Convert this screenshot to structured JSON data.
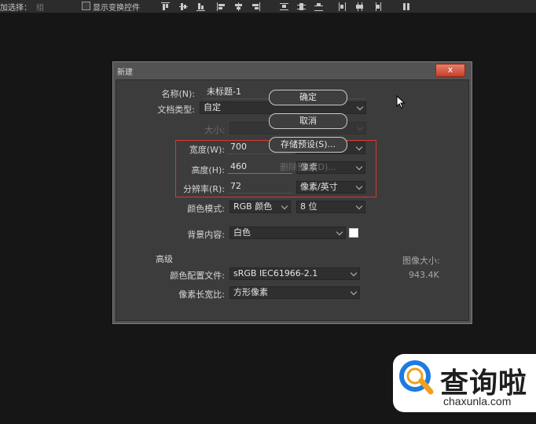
{
  "toolbar": {
    "select_label": "加选择：",
    "select_value": "组",
    "show_transform_label": "显示变换控件"
  },
  "dialog": {
    "title": "新建",
    "close_symbol": "x",
    "name_label": "名称(N):",
    "name_value": "未标题-1",
    "doc_type_label": "文档类型:",
    "doc_type_value": "自定",
    "size_label": "大小:",
    "width_label": "宽度(W):",
    "width_value": "700",
    "width_unit": "像素",
    "height_label": "高度(H):",
    "height_value": "460",
    "height_unit": "像素",
    "resolution_label": "分辨率(R):",
    "resolution_value": "72",
    "resolution_unit": "像素/英寸",
    "color_mode_label": "颜色模式:",
    "color_mode_value": "RGB 颜色",
    "bit_depth_value": "8 位",
    "background_label": "背景内容:",
    "background_value": "白色",
    "background_swatch_color": "#ffffff",
    "advanced_label": "高级",
    "color_profile_label": "颜色配置文件:",
    "color_profile_value": "sRGB IEC61966-2.1",
    "pixel_aspect_label": "像素长宽比:",
    "pixel_aspect_value": "方形像素",
    "image_size_label": "图像大小:",
    "image_size_value": "943.4K",
    "buttons": {
      "ok": "确定",
      "cancel": "取消",
      "save_preset": "存储预设(S)...",
      "delete_preset": "删除预设(D)..."
    },
    "highlight_color": "#d83a2e"
  },
  "watermark": {
    "chinese": "查询啦",
    "domain": "chaxunla.com",
    "brand_color": "#1d7be0"
  }
}
